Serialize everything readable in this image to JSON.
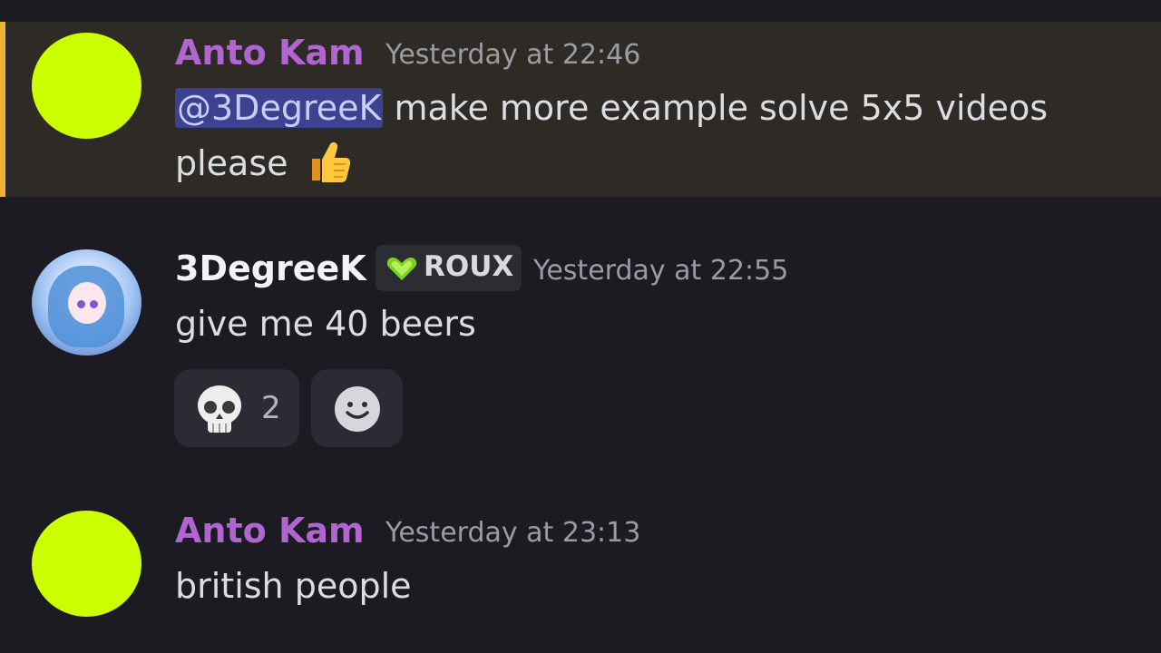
{
  "messages": [
    {
      "author": "Anto Kam",
      "timestamp": "Yesterday at 22:46",
      "mention": "@3DegreeK",
      "text_line1": " make more example solve 5x5 videos",
      "text_line2": "please",
      "emoji": "thumbs-up-icon"
    },
    {
      "author": "3DegreeK",
      "role_tag": "ROUX",
      "timestamp": "Yesterday at 22:55",
      "text": "give me 40 beers",
      "reactions": [
        {
          "emoji": "skull-icon",
          "count": "2"
        },
        {
          "emoji": "add-reaction-icon"
        }
      ]
    },
    {
      "author": "Anto Kam",
      "timestamp": "Yesterday at 23:13",
      "text": "british people"
    }
  ],
  "colors": {
    "background": "#1b1b21",
    "highlight_bg": "#2e2b26",
    "highlight_bar": "#f0b232",
    "author_anto": "#b065d1",
    "avatar_anto": "#ccff00",
    "mention_bg": "#3c4190",
    "role_heart": "#7ed321"
  }
}
